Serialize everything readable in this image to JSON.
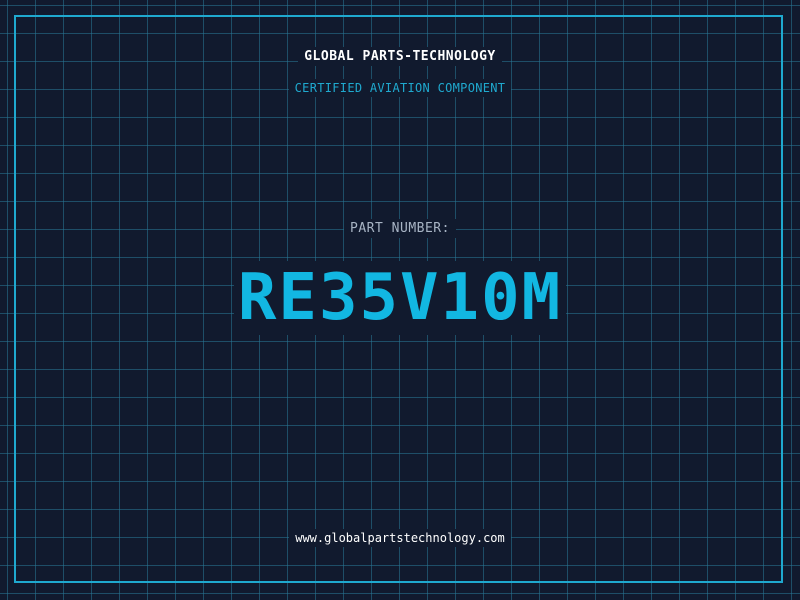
{
  "header": {
    "company": "GLOBAL PARTS-TECHNOLOGY",
    "subtitle": "CERTIFIED AVIATION COMPONENT"
  },
  "part": {
    "label": "PART NUMBER:",
    "number": "RE35V10M"
  },
  "footer": {
    "url": "www.globalpartstechnology.com"
  },
  "colors": {
    "background": "#111a2e",
    "grid": "#28789a",
    "accent": "#1fa9cf",
    "part_number": "#12b7e2",
    "label": "#a8b4c4",
    "text": "#ffffff"
  }
}
